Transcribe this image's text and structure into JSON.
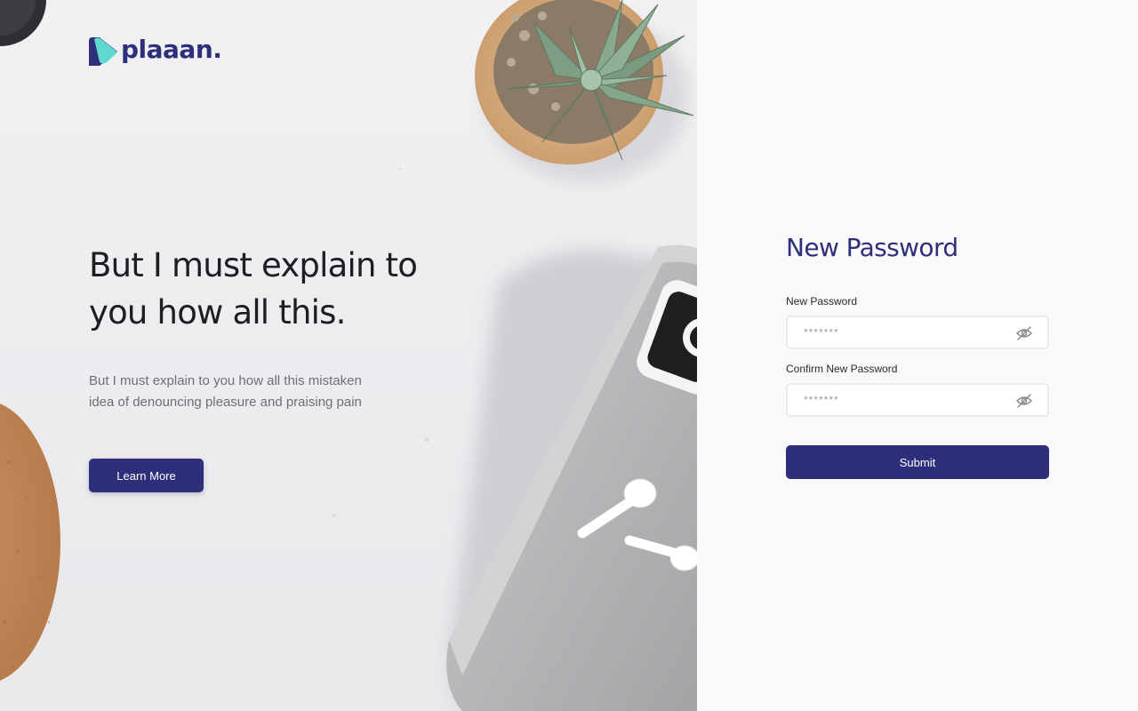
{
  "brand": {
    "name": "plaaan.",
    "primary_color": "#2e2f7a",
    "accent_color": "#5fd9d0"
  },
  "hero": {
    "headline": "But I must explain to you how all this.",
    "subtext": "But I must explain to you how all this mistaken idea of denouncing pleasure and praising pain",
    "cta_label": "Learn More"
  },
  "form": {
    "title": "New Password",
    "fields": [
      {
        "label": "New Password",
        "placeholder": "*******",
        "icon": "eye-off-icon"
      },
      {
        "label": "Confirm New Password",
        "placeholder": "*******",
        "icon": "eye-off-icon"
      }
    ],
    "submit_label": "Submit"
  }
}
